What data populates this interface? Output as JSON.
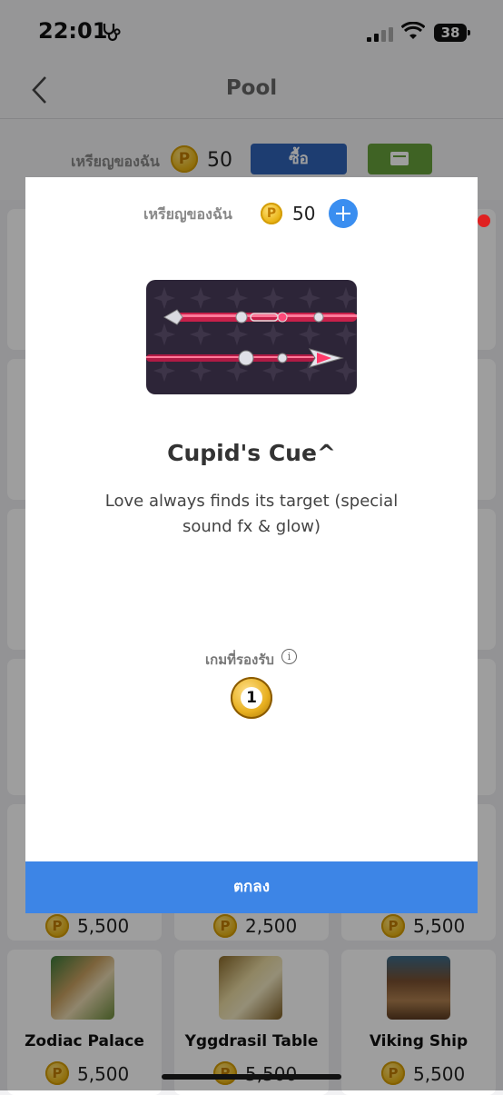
{
  "status_bar": {
    "time": "22:01",
    "battery": "38"
  },
  "nav": {
    "title": "Pool"
  },
  "wallet": {
    "label": "เหรียญของฉัน",
    "coins": "50",
    "buy_label": "ซื้อ"
  },
  "modal": {
    "wallet_label": "เหรียญของฉัน",
    "coins": "50",
    "coin_symbol": "P",
    "item_name": "Cupid's Cue^",
    "item_desc": "Love always finds its target (special sound fx & glow)",
    "supported_games_label": "เกมที่รองรับ",
    "info_glyph": "i",
    "game_ball_number": "1",
    "ok_label": "ตกลง"
  },
  "tiles_row1": [
    {
      "price": "5,500"
    },
    {
      "price": "2,500"
    },
    {
      "price": "5,500"
    }
  ],
  "tiles_row2": [
    {
      "name": "Zodiac Palace",
      "price": "5,500"
    },
    {
      "name": "Yggdrasil Table",
      "price": "5,500"
    },
    {
      "name": "Viking Ship",
      "price": "5,500"
    }
  ],
  "colors": {
    "accent_blue": "#3d85e6",
    "buy_blue": "#2f63b6",
    "wallet_green": "#66a03a",
    "coin_gold": "#e9b416"
  }
}
